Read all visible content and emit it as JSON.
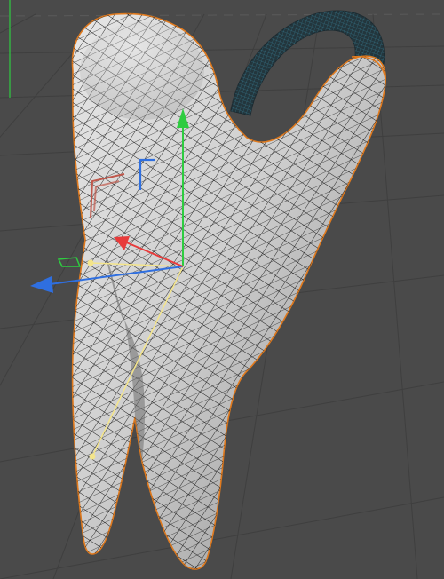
{
  "viewport": {
    "background": "#4a4a4a",
    "grid_color": "#3f3f3f",
    "horizon_color": "#5a5a5a"
  },
  "object": {
    "type": "tooth-mesh-with-handle",
    "mesh_fill": "#d2d2d2",
    "mesh_shade": "#8e8e8e",
    "wire_color": "#1a1a1a",
    "selection_outline": "#e07a1e",
    "handle_color": "#23363d",
    "handle_wire": "#3f97b3"
  },
  "gizmo": {
    "x_axis_color": "#e83b3b",
    "y_axis_color": "#2ecc40",
    "z_axis_color": "#2f6fe0",
    "light_line_color": "#f4e58a",
    "icons": [
      "move-y-arrow-icon",
      "move-z-arrow-icon",
      "move-x-arrow-icon",
      "rotate-handle-icon",
      "light-target-icon"
    ]
  }
}
